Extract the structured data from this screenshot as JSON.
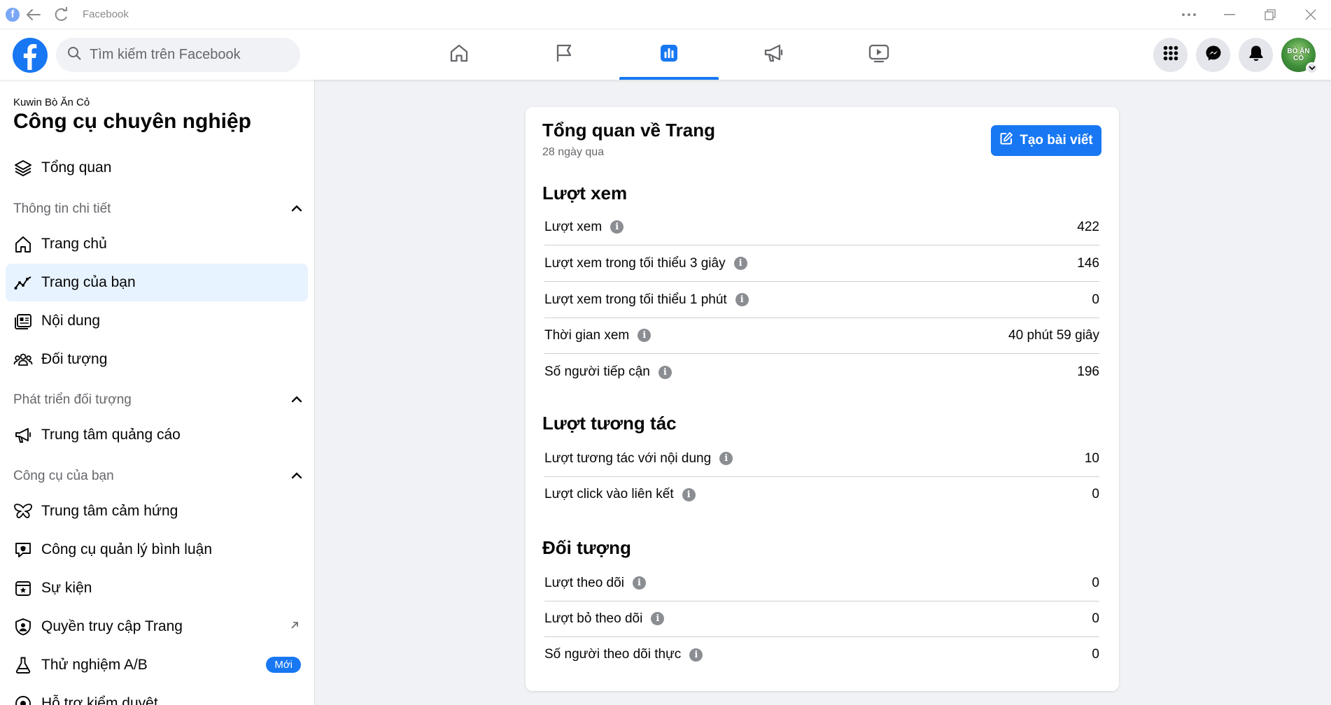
{
  "titlebar": {
    "title": "Facebook"
  },
  "search": {
    "placeholder": "Tìm kiếm trên Facebook"
  },
  "nav": {
    "tabs": [
      {
        "name": "home",
        "icon": "home-icon"
      },
      {
        "name": "pages",
        "icon": "flag-icon"
      },
      {
        "name": "insights",
        "icon": "bar-chart-icon",
        "active": true
      },
      {
        "name": "ads",
        "icon": "megaphone-icon"
      },
      {
        "name": "watch",
        "icon": "video-icon"
      }
    ],
    "avatar_text": "BÒ ĂN CỎ"
  },
  "sidebar": {
    "page_name": "Kuwin Bò Ăn Cỏ",
    "title": "Công cụ chuyên nghiệp",
    "overview": "Tổng quan",
    "section_insights": "Thông tin chi tiết",
    "home": "Trang chủ",
    "your_page": "Trang của bạn",
    "content": "Nội dung",
    "audience": "Đối tượng",
    "section_growth": "Phát triển đối tượng",
    "ads_center": "Trung tâm quảng cáo",
    "section_tools": "Công cụ của bạn",
    "inspiration": "Trung tâm cảm hứng",
    "comment_mgmt": "Công cụ quản lý bình luận",
    "events": "Sự kiện",
    "page_access": "Quyền truy cập Trang",
    "ab_test": "Thử nghiệm A/B",
    "ab_badge": "Mới",
    "moderation": "Hỗ trợ kiểm duyệt"
  },
  "card": {
    "title": "Tổng quan về Trang",
    "subtitle": "28 ngày qua",
    "create_post": "Tạo bài viết",
    "views_section": "Lượt xem",
    "views": [
      {
        "label": "Lượt xem",
        "value": "422"
      },
      {
        "label": "Lượt xem trong tối thiểu 3 giây",
        "value": "146"
      },
      {
        "label": "Lượt xem trong tối thiểu 1 phút",
        "value": "0"
      },
      {
        "label": "Thời gian xem",
        "value": "40 phút 59 giây"
      },
      {
        "label": "Số người tiếp cận",
        "value": "196"
      }
    ],
    "engagement_section": "Lượt tương tác",
    "engagement": [
      {
        "label": "Lượt tương tác với nội dung",
        "value": "10"
      },
      {
        "label": "Lượt click vào liên kết",
        "value": "0"
      }
    ],
    "audience_section": "Đối tượng",
    "audience": [
      {
        "label": "Lượt theo dõi",
        "value": "0"
      },
      {
        "label": "Lượt bỏ theo dõi",
        "value": "0"
      },
      {
        "label": "Số người theo dõi thực",
        "value": "0"
      }
    ],
    "info_glyph": "i"
  },
  "colors": {
    "accent": "#1877f2",
    "active_bg": "#e7f3ff",
    "background": "#f0f2f5"
  }
}
